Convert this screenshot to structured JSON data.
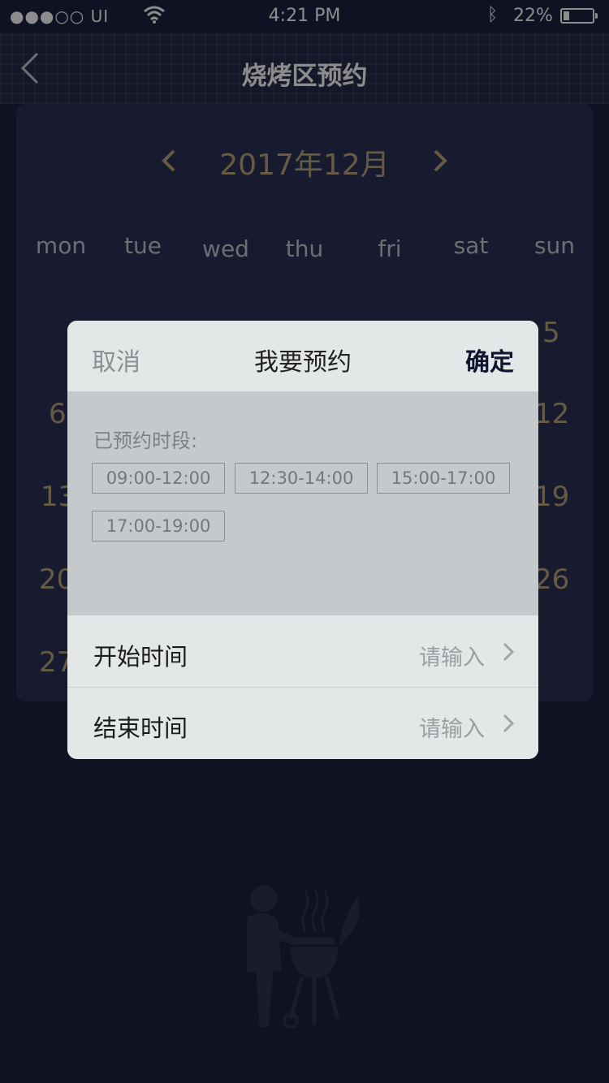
{
  "status_bar": {
    "signal": "●●●○○ UI",
    "time": "4:21 PM",
    "battery": "22%",
    "battery_level": 0.22
  },
  "nav": {
    "title": "烧烤区预约",
    "back_icon": "chevron-left-icon"
  },
  "calendar": {
    "month_label": "2017年12月",
    "weekdays": [
      "mon",
      "tue",
      "wed",
      "thu",
      "fri",
      "sat",
      "sun"
    ],
    "visible_days": [
      "5",
      "6",
      "12",
      "13",
      "19",
      "20",
      "26",
      "27"
    ]
  },
  "modal": {
    "cancel_label": "取消",
    "title": "我要预约",
    "confirm_label": "确定",
    "booked_label": "已预约时段:",
    "booked_slots": [
      "09:00-12:00",
      "12:30-14:00",
      "15:00-17:00",
      "17:00-19:00"
    ],
    "rows": [
      {
        "label": "开始时间",
        "placeholder": "请输入"
      },
      {
        "label": "结束时间",
        "placeholder": "请输入"
      }
    ]
  },
  "colors": {
    "background": "#1d2140",
    "accent_gold": "#b9a67e",
    "modal_bg": "#e4e7e8",
    "booked_bg": "#c6c9cc"
  }
}
